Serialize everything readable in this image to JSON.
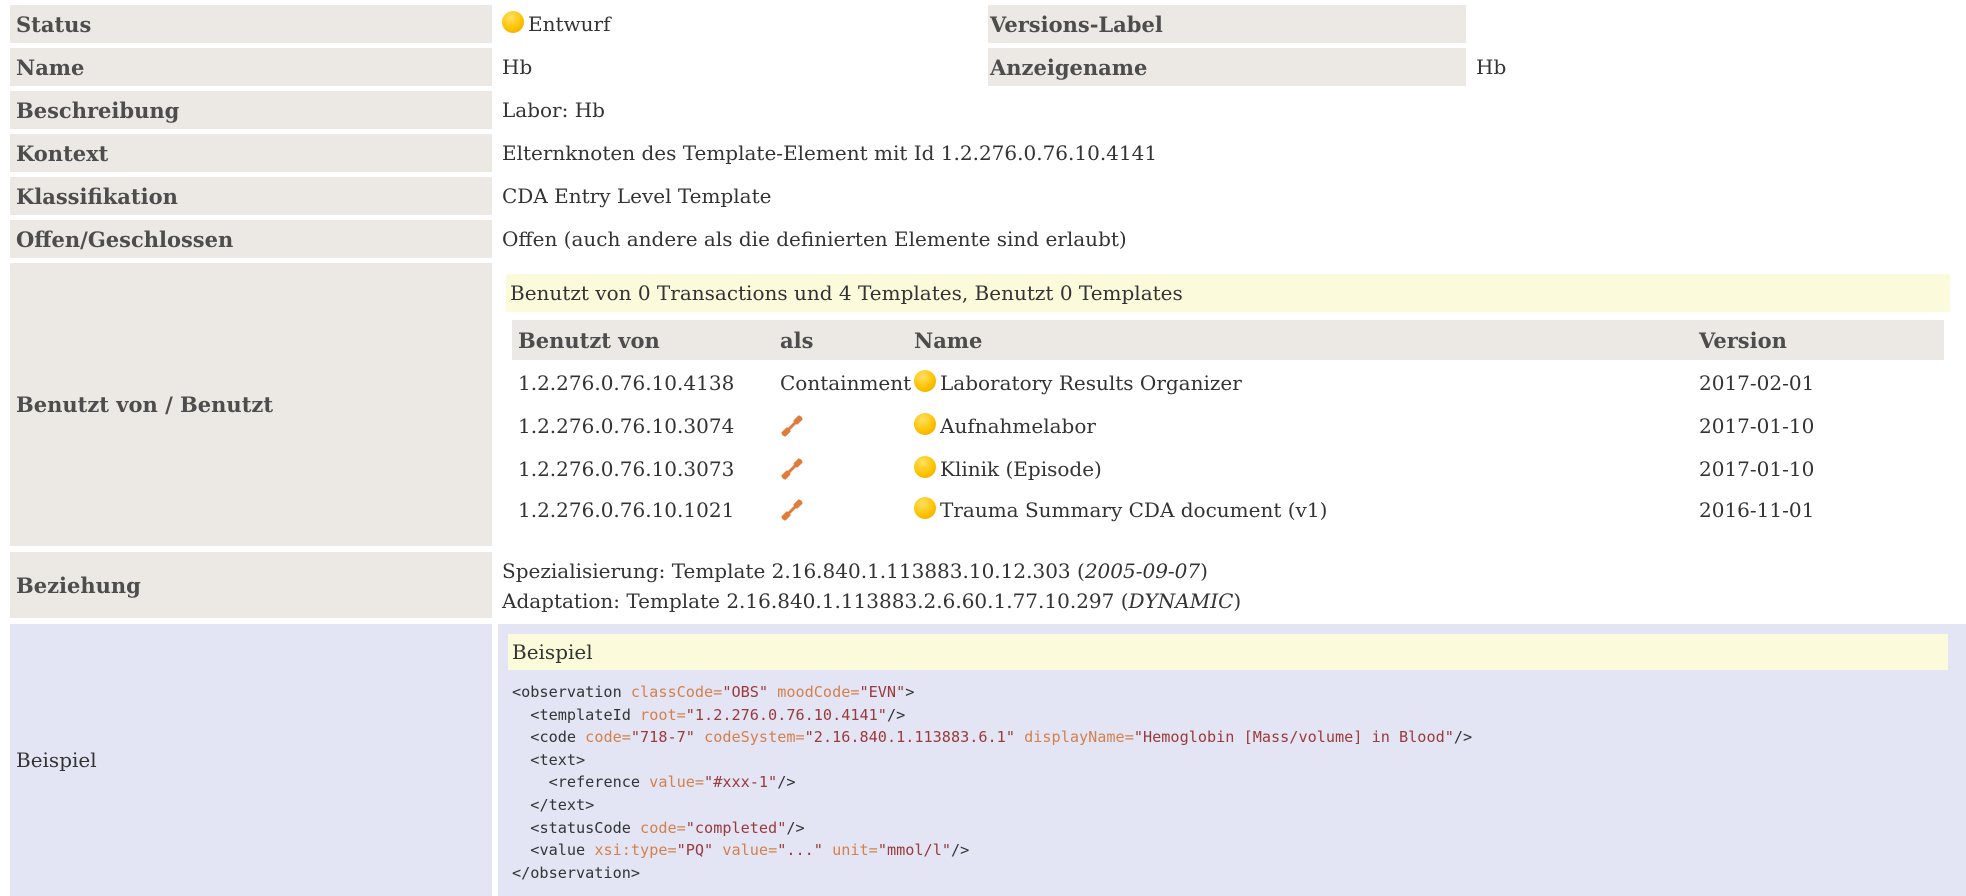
{
  "rows": {
    "status": {
      "label": "Status",
      "value": "Entwurf"
    },
    "versions_label": {
      "label": "Versions-Label",
      "value": ""
    },
    "name": {
      "label": "Name",
      "value": "Hb"
    },
    "anzeigename": {
      "label": "Anzeigename",
      "value": "Hb"
    },
    "beschreibung": {
      "label": "Beschreibung",
      "value": "Labor: Hb"
    },
    "kontext": {
      "label": "Kontext",
      "value": "Elternknoten des Template-Element mit Id 1.2.276.0.76.10.4141"
    },
    "klassifikation": {
      "label": "Klassifikation",
      "value": "CDA Entry Level Template"
    },
    "offen": {
      "label": "Offen/Geschlossen",
      "value": "Offen (auch andere als die definierten Elemente sind erlaubt)"
    },
    "benutzt": {
      "label": "Benutzt von / Benutzt"
    },
    "beziehung": {
      "label": "Beziehung",
      "line1_prefix": "Spezialisierung: Template 2.16.840.1.113883.10.12.303 (",
      "line1_date": "2005-09-07",
      "line1_suffix": ")",
      "line2_prefix": "Adaptation: Template 2.16.840.1.113883.2.6.60.1.77.10.297 (",
      "line2_date": "DYNAMIC",
      "line2_suffix": ")"
    },
    "beispiel": {
      "label": "Beispiel",
      "header": "Beispiel"
    }
  },
  "usage": {
    "summary": "Benutzt von 0 Transactions und 4 Templates, Benutzt 0 Templates",
    "columns": [
      "Benutzt von",
      "als",
      "Name",
      "Version"
    ],
    "rows": [
      {
        "id": "1.2.276.0.76.10.4138",
        "als": "Containment",
        "als_icon": "",
        "name": "Laboratory Results Organizer",
        "version": "2017-02-01"
      },
      {
        "id": "1.2.276.0.76.10.3074",
        "als": "",
        "als_icon": "chain-link-icon",
        "name": "Aufnahmelabor",
        "version": "2017-01-10"
      },
      {
        "id": "1.2.276.0.76.10.3073",
        "als": "",
        "als_icon": "chain-link-icon",
        "name": "Klinik (Episode)",
        "version": "2017-01-10"
      },
      {
        "id": "1.2.276.0.76.10.1021",
        "als": "",
        "als_icon": "chain-link-icon",
        "name": "Trauma Summary CDA document (v1)",
        "version": "2016-11-01"
      }
    ]
  },
  "example_code": {
    "line1": {
      "t1": "<observation",
      "a1": "classCode=",
      "v1": "\"OBS\"",
      "a2": "moodCode=",
      "v2": "\"EVN\"",
      "t2": ">"
    },
    "line2": {
      "t1": "<templateId",
      "a1": "root=",
      "v1": "\"1.2.276.0.76.10.4141\"",
      "t2": "/>"
    },
    "line3": {
      "t1": "<code",
      "a1": "code=",
      "v1": "\"718-7\"",
      "a2": "codeSystem=",
      "v2": "\"2.16.840.1.113883.6.1\"",
      "a3": "displayName=",
      "v3": "\"Hemoglobin [Mass/volume] in Blood\"",
      "t2": "/>"
    },
    "line4": {
      "t1": "<text>"
    },
    "line5": {
      "t1": "<reference",
      "a1": "value=",
      "v1": "\"#xxx-1\"",
      "t2": "/>"
    },
    "line6": {
      "t1": "</text>"
    },
    "line7": {
      "t1": "<statusCode",
      "a1": "code=",
      "v1": "\"completed\"",
      "t2": "/>"
    },
    "line8": {
      "t1": "<value",
      "a1": "xsi:type=",
      "v1": "\"PQ\"",
      "a2": "value=",
      "v2": "\"...\"",
      "a3": "unit=",
      "v3": "\"mmol/l\"",
      "t2": "/>"
    },
    "line9": {
      "t1": "</observation>"
    }
  },
  "colors": {
    "label_bg": "#ece9e4",
    "summary_bg": "#fbfbdc",
    "example_bg": "#e3e5f5",
    "status_dot": "#ffc300",
    "link_icon": "#e07b39",
    "attr_color": "#d4804c",
    "value_color": "#9a3a3a"
  }
}
